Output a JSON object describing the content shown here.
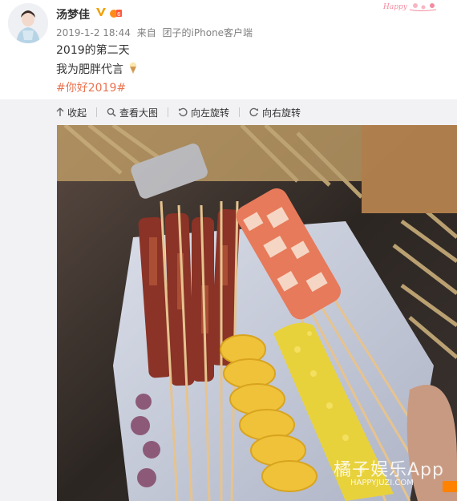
{
  "post": {
    "username": "汤梦佳",
    "date": "2019-1-2 18:44",
    "source_prefix": "来自",
    "source_device": "团子的iPhone客户端",
    "text_line1": "2019的第二天",
    "text_line2": "我为肥胖代言",
    "hashtag": "#你好2019#",
    "icons": [
      "vip-v-icon",
      "rank-badge-icon",
      "ice-cream-emoji-icon"
    ]
  },
  "toolbar": {
    "collapse_label": "收起",
    "view_large_label": "查看大图",
    "rotate_left_label": "向左旋转",
    "rotate_right_label": "向右旋转"
  },
  "photo": {
    "watermark_main": "橘子娱乐App",
    "watermark_sub": "HAPPYJUZI.COM"
  },
  "colors": {
    "hashtag": "#eb7350",
    "meta_text": "#808080",
    "vip_badge": "#f0a000",
    "panel_bg": "#f2f2f5"
  }
}
